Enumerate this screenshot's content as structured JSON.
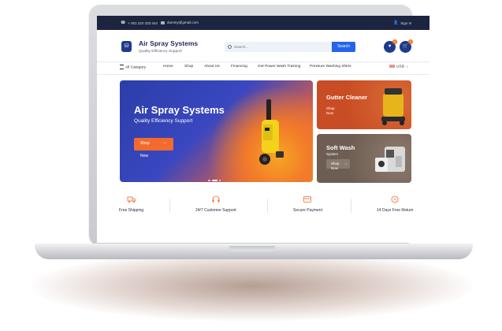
{
  "topbar": {
    "phone": "+ 001 222 333 444",
    "email": "dummy@gmail.com",
    "signin": "Sign In"
  },
  "brand": {
    "title": "Air Spray Systems",
    "subtitle": "Quality Efficiency Support"
  },
  "search": {
    "placeholder": "Search...",
    "button": "Search"
  },
  "header": {
    "wishlist_count": "0",
    "cart_count": "0"
  },
  "nav": {
    "category": "All Category",
    "items": [
      "Home",
      "Shop",
      "About Us",
      "Financing",
      "Get Power Wash Training",
      "Pressure Washing Shirts"
    ],
    "currency": "USD"
  },
  "hero": {
    "title": "Air Spray Systems",
    "subtitle": "Quality Efficiency Support",
    "button_line1": "Shop",
    "button_line2": "Now"
  },
  "cards": [
    {
      "title": "Gutter Cleaner",
      "sub": "",
      "button_line1": "Shop",
      "button_line2": "Now"
    },
    {
      "title": "Soft Wash",
      "sub": "System",
      "button_line1": "Shop",
      "button_line2": "Now"
    }
  ],
  "features": [
    "Free Shipping",
    "24/7 Customer Support",
    "Secure Payment",
    "14 Days Free Return"
  ],
  "colors": {
    "navy": "#1c2440",
    "primary": "#1e3a8a",
    "accent": "#f26a2e",
    "search": "#2563eb"
  }
}
